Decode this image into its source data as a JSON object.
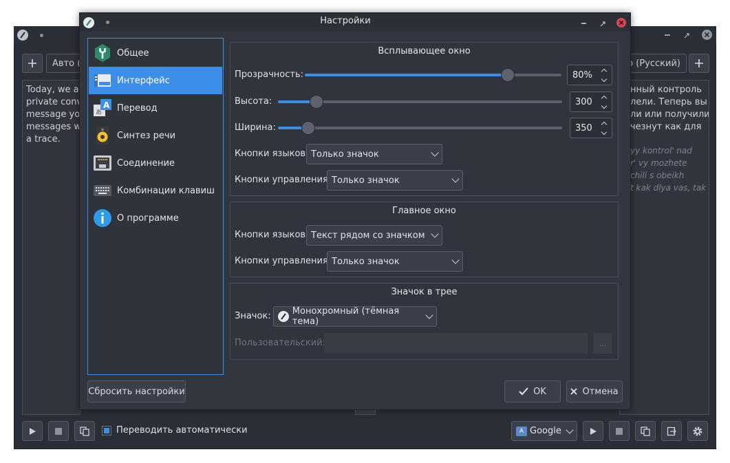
{
  "dialog": {
    "title": "Настройки",
    "sidebar": [
      {
        "label": "Общее",
        "icon": "gear-wrench-icon",
        "selected": false
      },
      {
        "label": "Интерфейс",
        "icon": "interface-window-icon",
        "selected": true
      },
      {
        "label": "Перевод",
        "icon": "translate-icon",
        "selected": false
      },
      {
        "label": "Синтез речи",
        "icon": "speaker-icon",
        "selected": false
      },
      {
        "label": "Соединение",
        "icon": "network-port-icon",
        "selected": false
      },
      {
        "label": "Комбинации клавиш",
        "icon": "keyboard-icon",
        "selected": false
      },
      {
        "label": "О программе",
        "icon": "info-icon",
        "selected": false
      }
    ],
    "popup_group": {
      "title": "Всплывающее окно",
      "opacity": {
        "label": "Прозрачность:",
        "value": "80%",
        "level": 0.8
      },
      "height": {
        "label": "Высота:",
        "value": "300",
        "level": 0.13
      },
      "width": {
        "label": "Ширина:",
        "value": "350",
        "level": 0.1
      },
      "lang_buttons": {
        "label": "Кнопки языков:",
        "value": "Только значок"
      },
      "control_buttons": {
        "label": "Кнопки управления:",
        "value": "Только значок"
      }
    },
    "main_group": {
      "title": "Главное окно",
      "lang_buttons": {
        "label": "Кнопки языков:",
        "value": "Текст рядом со значком"
      },
      "control_buttons": {
        "label": "Кнопки управления:",
        "value": "Только значок"
      }
    },
    "tray_group": {
      "title": "Значок в трее",
      "icon": {
        "label": "Значок:",
        "value": "Монохромный (тёмная тема)"
      },
      "custom": {
        "label": "Пользовательский:",
        "browse": "..."
      }
    },
    "reset_button": "Сбросить настройки",
    "ok_button": "OK",
    "cancel_button": "Отмена"
  },
  "background": {
    "source_lang_tab": "Авто (А",
    "target_lang_tab": "то (Русский)",
    "source_text": [
      "Today, we are",
      "private conve",
      "message you",
      "messages wil",
      "a trace."
    ],
    "target_text": [
      "нный контроль",
      "лели. Теперь вы",
      "ли или получили",
      "чезнут как для"
    ],
    "translit_text": [
      "yy kontrol' nad",
      "r' vy mozhete",
      "chili s obeikh",
      "t kak dlya vas, tak"
    ],
    "auto_translate": "Переводить автоматически",
    "engine": "Google"
  },
  "colors": {
    "accent": "#3d8ee6",
    "window": "#31363f",
    "titlebar": "#2b2f36",
    "close": "#da4453"
  }
}
